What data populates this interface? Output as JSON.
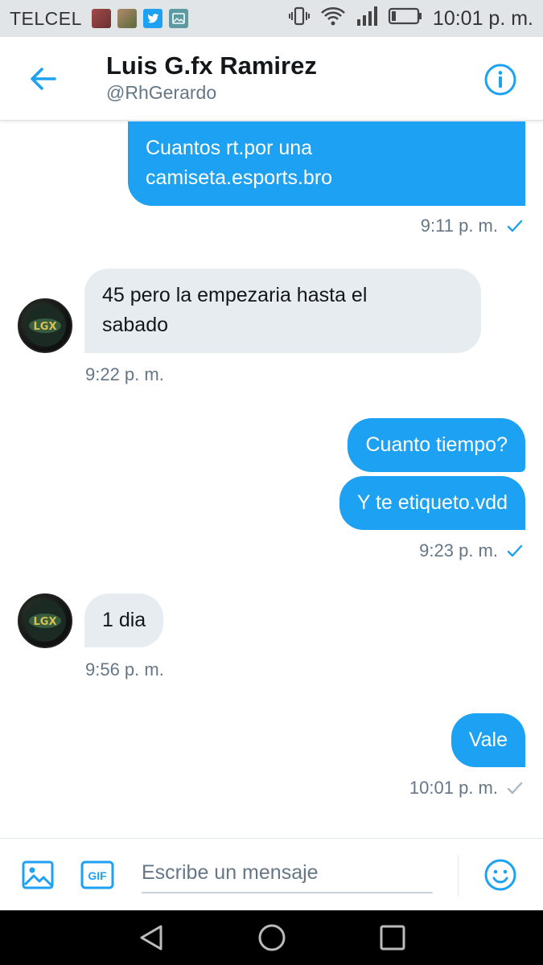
{
  "statusbar": {
    "carrier": "TELCEL",
    "time": "10:01 p. m.",
    "notification_icons": [
      "photo-notification-icon",
      "photo-notification-icon",
      "twitter-bird-icon",
      "gallery-icon"
    ],
    "system_icons": [
      "vibrate-icon",
      "wifi-icon",
      "signal-icon",
      "battery-icon"
    ]
  },
  "header": {
    "title": "Luis G.fx Ramirez",
    "handle": "@RhGerardo"
  },
  "messages": [
    {
      "direction": "sent",
      "text_lines": [
        "Cuantos rt.por una",
        "camiseta.esports.bro"
      ],
      "time": "9:11 p. m.",
      "status": "read"
    },
    {
      "direction": "received",
      "text_lines": [
        "45 pero la empezaria hasta el",
        "sabado"
      ],
      "time": "9:22 p. m."
    },
    {
      "direction": "sent",
      "text": "Cuanto tiempo?"
    },
    {
      "direction": "sent",
      "text": "Y te etiqueto.vdd",
      "time": "9:23 p. m.",
      "status": "read"
    },
    {
      "direction": "received",
      "text": "1 dia",
      "time": "9:56 p. m."
    },
    {
      "direction": "sent",
      "text": "Vale",
      "time": "10:01 p. m.",
      "status": "sent"
    }
  ],
  "composer": {
    "placeholder": "Escribe un mensaje",
    "gif_label": "GIF"
  },
  "colors": {
    "accent": "#1da1f2",
    "received_bubble": "#e6ecf0",
    "secondary_text": "#657786",
    "statusbar_bg": "#e1e5e8"
  }
}
